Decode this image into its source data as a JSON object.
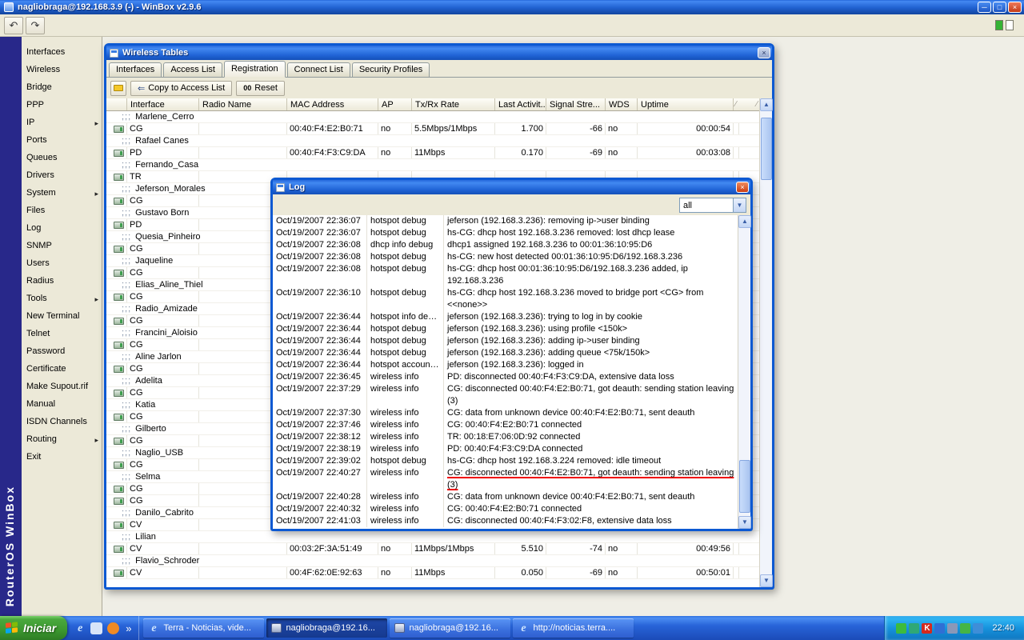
{
  "icons": {
    "minimize": "─",
    "maximize": "□",
    "close": "×",
    "undo": "↶",
    "redo": "↷",
    "submenu_arrow": "▸",
    "left_arrow": "⇐",
    "dropdown_arrow": "▼",
    "scroll_up": "▲",
    "scroll_down": "▼",
    "chevron": "»",
    "sort_slash": "∕"
  },
  "window": {
    "title": "nagliobraga@192.168.3.9 (-) - WinBox v2.9.6",
    "brand_vertical": "RouterOS WinBox"
  },
  "sidebar": {
    "items": [
      {
        "label": "Interfaces",
        "arrow": false
      },
      {
        "label": "Wireless",
        "arrow": false
      },
      {
        "label": "Bridge",
        "arrow": false
      },
      {
        "label": "PPP",
        "arrow": false
      },
      {
        "label": "IP",
        "arrow": true
      },
      {
        "label": "Ports",
        "arrow": false
      },
      {
        "label": "Queues",
        "arrow": false
      },
      {
        "label": "Drivers",
        "arrow": false
      },
      {
        "label": "System",
        "arrow": true
      },
      {
        "label": "Files",
        "arrow": false
      },
      {
        "label": "Log",
        "arrow": false
      },
      {
        "label": "SNMP",
        "arrow": false
      },
      {
        "label": "Users",
        "arrow": false
      },
      {
        "label": "Radius",
        "arrow": false
      },
      {
        "label": "Tools",
        "arrow": true
      },
      {
        "label": "New Terminal",
        "arrow": false
      },
      {
        "label": "Telnet",
        "arrow": false
      },
      {
        "label": "Password",
        "arrow": false
      },
      {
        "label": "Certificate",
        "arrow": false
      },
      {
        "label": "Make Supout.rif",
        "arrow": false
      },
      {
        "label": "Manual",
        "arrow": false
      },
      {
        "label": "ISDN Channels",
        "arrow": false
      },
      {
        "label": "Routing",
        "arrow": true
      },
      {
        "label": "Exit",
        "arrow": false
      }
    ]
  },
  "wireless_tables": {
    "title": "Wireless Tables",
    "tabs": [
      "Interfaces",
      "Access List",
      "Registration",
      "Connect List",
      "Security Profiles"
    ],
    "active_tab": "Registration",
    "toolbar": {
      "copy_label": "Copy to Access List",
      "reset_icon": "00",
      "reset_label": "Reset"
    },
    "comment_prefix": ";;;",
    "columns": [
      "Interface",
      "Radio Name",
      "MAC Address",
      "AP",
      "Tx/Rx Rate",
      "Last Activit...",
      "Signal Stre...",
      "WDS",
      "Uptime"
    ],
    "rows": [
      {
        "type": "comment",
        "label": "Marlene_Cerro"
      },
      {
        "type": "data",
        "iface": "CG",
        "radio": "",
        "mac": "00:40:F4:E2:B0:71",
        "ap": "no",
        "rate": "5.5Mbps/1Mbps",
        "last": "1.700",
        "signal": "-66",
        "wds": "no",
        "uptime": "00:00:54"
      },
      {
        "type": "comment",
        "label": "Rafael Canes"
      },
      {
        "type": "data",
        "iface": "PD",
        "radio": "",
        "mac": "00:40:F4:F3:C9:DA",
        "ap": "no",
        "rate": "11Mbps",
        "last": "0.170",
        "signal": "-69",
        "wds": "no",
        "uptime": "00:03:08"
      },
      {
        "type": "comment",
        "label": "Fernando_Casa"
      },
      {
        "type": "data",
        "iface": "TR",
        "radio": "",
        "mac": "",
        "ap": "",
        "rate": "",
        "last": "",
        "signal": "",
        "wds": "",
        "uptime": ""
      },
      {
        "type": "comment",
        "label": "Jeferson_Morales"
      },
      {
        "type": "data",
        "iface": "CG",
        "radio": "",
        "mac": "",
        "ap": "",
        "rate": "",
        "last": "",
        "signal": "",
        "wds": "",
        "uptime": ""
      },
      {
        "type": "comment",
        "label": "Gustavo Born"
      },
      {
        "type": "data",
        "iface": "PD",
        "radio": "",
        "mac": "",
        "ap": "",
        "rate": "",
        "last": "",
        "signal": "",
        "wds": "",
        "uptime": ""
      },
      {
        "type": "comment",
        "label": "Quesia_Pinheiro"
      },
      {
        "type": "data",
        "iface": "CG",
        "radio": "",
        "mac": "",
        "ap": "",
        "rate": "",
        "last": "",
        "signal": "",
        "wds": "",
        "uptime": ""
      },
      {
        "type": "comment",
        "label": "Jaqueline"
      },
      {
        "type": "data",
        "iface": "CG",
        "radio": "",
        "mac": "",
        "ap": "",
        "rate": "",
        "last": "",
        "signal": "",
        "wds": "",
        "uptime": ""
      },
      {
        "type": "comment",
        "label": "Elias_Aline_Thiel"
      },
      {
        "type": "data",
        "iface": "CG",
        "radio": "",
        "mac": "",
        "ap": "",
        "rate": "",
        "last": "",
        "signal": "",
        "wds": "",
        "uptime": ""
      },
      {
        "type": "comment",
        "label": "Radio_Amizade"
      },
      {
        "type": "data",
        "iface": "CG",
        "radio": "",
        "mac": "",
        "ap": "",
        "rate": "",
        "last": "",
        "signal": "",
        "wds": "",
        "uptime": ""
      },
      {
        "type": "comment",
        "label": "Francini_Aloisio"
      },
      {
        "type": "data",
        "iface": "CG",
        "radio": "",
        "mac": "",
        "ap": "",
        "rate": "",
        "last": "",
        "signal": "",
        "wds": "",
        "uptime": ""
      },
      {
        "type": "comment",
        "label": "Aline Jarlon"
      },
      {
        "type": "data",
        "iface": "CG",
        "radio": "",
        "mac": "",
        "ap": "",
        "rate": "",
        "last": "",
        "signal": "",
        "wds": "",
        "uptime": ""
      },
      {
        "type": "comment",
        "label": "Adelita"
      },
      {
        "type": "data",
        "iface": "CG",
        "radio": "",
        "mac": "",
        "ap": "",
        "rate": "",
        "last": "",
        "signal": "",
        "wds": "",
        "uptime": ""
      },
      {
        "type": "comment",
        "label": "Katia"
      },
      {
        "type": "data",
        "iface": "CG",
        "radio": "",
        "mac": "",
        "ap": "",
        "rate": "",
        "last": "",
        "signal": "",
        "wds": "",
        "uptime": ""
      },
      {
        "type": "comment",
        "label": "Gilberto"
      },
      {
        "type": "data",
        "iface": "CG",
        "radio": "",
        "mac": "",
        "ap": "",
        "rate": "",
        "last": "",
        "signal": "",
        "wds": "",
        "uptime": ""
      },
      {
        "type": "comment",
        "label": "Naglio_USB"
      },
      {
        "type": "data",
        "iface": "CG",
        "radio": "",
        "mac": "",
        "ap": "",
        "rate": "",
        "last": "",
        "signal": "",
        "wds": "",
        "uptime": ""
      },
      {
        "type": "comment",
        "label": "Selma"
      },
      {
        "type": "data",
        "iface": "CG",
        "radio": "",
        "mac": "",
        "ap": "",
        "rate": "",
        "last": "",
        "signal": "",
        "wds": "",
        "uptime": ""
      },
      {
        "type": "data",
        "iface": "CG",
        "radio": "",
        "mac": "",
        "ap": "",
        "rate": "",
        "last": "",
        "signal": "",
        "wds": "",
        "uptime": ""
      },
      {
        "type": "comment",
        "label": "Danilo_Cabrito"
      },
      {
        "type": "data",
        "iface": "CV",
        "radio": "",
        "mac": "",
        "ap": "",
        "rate": "",
        "last": "",
        "signal": "",
        "wds": "",
        "uptime": ""
      },
      {
        "type": "comment",
        "label": "Lilian"
      },
      {
        "type": "data",
        "iface": "CV",
        "radio": "",
        "mac": "00:03:2F:3A:51:49",
        "ap": "no",
        "rate": "11Mbps/1Mbps",
        "last": "5.510",
        "signal": "-74",
        "wds": "no",
        "uptime": "00:49:56"
      },
      {
        "type": "comment",
        "label": "Flavio_Schroder"
      },
      {
        "type": "data",
        "iface": "CV",
        "radio": "",
        "mac": "00:4F:62:0E:92:63",
        "ap": "no",
        "rate": "11Mbps",
        "last": "0.050",
        "signal": "-69",
        "wds": "no",
        "uptime": "00:50:01"
      }
    ]
  },
  "log_window": {
    "title": "Log",
    "filter_value": "all",
    "entries": [
      {
        "time": "Oct/19/2007 22:36:07",
        "topics": "hotspot debug",
        "message": "jeferson (192.168.3.236): removing ip->user binding"
      },
      {
        "time": "Oct/19/2007 22:36:07",
        "topics": "hotspot debug",
        "message": "hs-CG: dhcp host 192.168.3.236 removed: lost dhcp lease"
      },
      {
        "time": "Oct/19/2007 22:36:08",
        "topics": "dhcp info debug",
        "message": "dhcp1 assigned 192.168.3.236 to 00:01:36:10:95:D6"
      },
      {
        "time": "Oct/19/2007 22:36:08",
        "topics": "hotspot debug",
        "message": "hs-CG: new host detected 00:01:36:10:95:D6/192.168.3.236"
      },
      {
        "time": "Oct/19/2007 22:36:08",
        "topics": "hotspot debug",
        "message": "hs-CG: dhcp host 00:01:36:10:95:D6/192.168.3.236 added, ip 192.168.3.236"
      },
      {
        "time": "Oct/19/2007 22:36:10",
        "topics": "hotspot debug",
        "message": "hs-CG: dhcp host 192.168.3.236 moved to bridge port <CG> from <<none>>"
      },
      {
        "time": "Oct/19/2007 22:36:44",
        "topics": "hotspot info debug",
        "message": "jeferson (192.168.3.236): trying to log in by cookie"
      },
      {
        "time": "Oct/19/2007 22:36:44",
        "topics": "hotspot debug",
        "message": "jeferson (192.168.3.236): using profile <150k>"
      },
      {
        "time": "Oct/19/2007 22:36:44",
        "topics": "hotspot debug",
        "message": "jeferson (192.168.3.236): adding ip->user binding"
      },
      {
        "time": "Oct/19/2007 22:36:44",
        "topics": "hotspot debug",
        "message": "jeferson (192.168.3.236): adding queue <75k/150k>"
      },
      {
        "time": "Oct/19/2007 22:36:44",
        "topics": "hotspot account in...",
        "message": "jeferson (192.168.3.236): logged in"
      },
      {
        "time": "Oct/19/2007 22:36:45",
        "topics": "wireless info",
        "message": "PD: disconnected 00:40:F4:F3:C9:DA, extensive data loss"
      },
      {
        "time": "Oct/19/2007 22:37:29",
        "topics": "wireless info",
        "message": "CG: disconnected 00:40:F4:E2:B0:71, got deauth: sending station leaving (3)"
      },
      {
        "time": "Oct/19/2007 22:37:30",
        "topics": "wireless info",
        "message": "CG: data from unknown device 00:40:F4:E2:B0:71, sent deauth"
      },
      {
        "time": "Oct/19/2007 22:37:46",
        "topics": "wireless info",
        "message": "CG: 00:40:F4:E2:B0:71 connected"
      },
      {
        "time": "Oct/19/2007 22:38:12",
        "topics": "wireless info",
        "message": "TR: 00:18:E7:06:0D:92 connected"
      },
      {
        "time": "Oct/19/2007 22:38:19",
        "topics": "wireless info",
        "message": "PD: 00:40:F4:F3:C9:DA connected"
      },
      {
        "time": "Oct/19/2007 22:39:02",
        "topics": "hotspot debug",
        "message": "hs-CG: dhcp host 192.168.3.224 removed: idle timeout"
      },
      {
        "time": "Oct/19/2007 22:40:27",
        "topics": "wireless info",
        "message": "CG: disconnected 00:40:F4:E2:B0:71, got deauth: sending station leaving (3)",
        "highlight": true
      },
      {
        "time": "Oct/19/2007 22:40:28",
        "topics": "wireless info",
        "message": "CG: data from unknown device 00:40:F4:E2:B0:71, sent deauth"
      },
      {
        "time": "Oct/19/2007 22:40:32",
        "topics": "wireless info",
        "message": "CG: 00:40:F4:E2:B0:71 connected"
      },
      {
        "time": "Oct/19/2007 22:41:03",
        "topics": "wireless info",
        "message": "CG: disconnected 00:40:F4:F3:02:F8, extensive data loss"
      }
    ],
    "highlight_color": "#f00000"
  },
  "taskbar": {
    "start_label": "Iniciar",
    "quick_launch": [
      {
        "name": "internet-explorer-icon",
        "glyph": "e",
        "color": "#CFE6FF"
      },
      {
        "name": "show-desktop-icon",
        "glyph": "",
        "color": "#D8E4F8"
      },
      {
        "name": "firefox-icon",
        "glyph": "",
        "color": "#F08A24"
      }
    ],
    "tasks": [
      {
        "label": "Terra - Noticias, vide...",
        "icon": "ie",
        "active": false
      },
      {
        "label": "nagliobraga@192.16...",
        "icon": "winbox",
        "active": true
      },
      {
        "label": "nagliobraga@192.16...",
        "icon": "winbox",
        "active": false
      },
      {
        "label": "http://noticias.terra....",
        "icon": "ie",
        "active": false
      }
    ],
    "tray_icons": [
      {
        "name": "network-status-icon",
        "color": "#3DBB3D",
        "glyph": ""
      },
      {
        "name": "connection-icon",
        "color": "#2FA876",
        "glyph": ""
      },
      {
        "name": "kaspersky-icon",
        "color": "#D42A1E",
        "glyph": "K"
      },
      {
        "name": "update-icon",
        "color": "#2F6FD4",
        "glyph": ""
      },
      {
        "name": "volume-icon",
        "color": "#8A98B8",
        "glyph": ""
      },
      {
        "name": "messenger-icon",
        "color": "#45B545",
        "glyph": ""
      },
      {
        "name": "search-icon",
        "color": "#3E8ED8",
        "glyph": ""
      }
    ],
    "clock": "22:40"
  }
}
